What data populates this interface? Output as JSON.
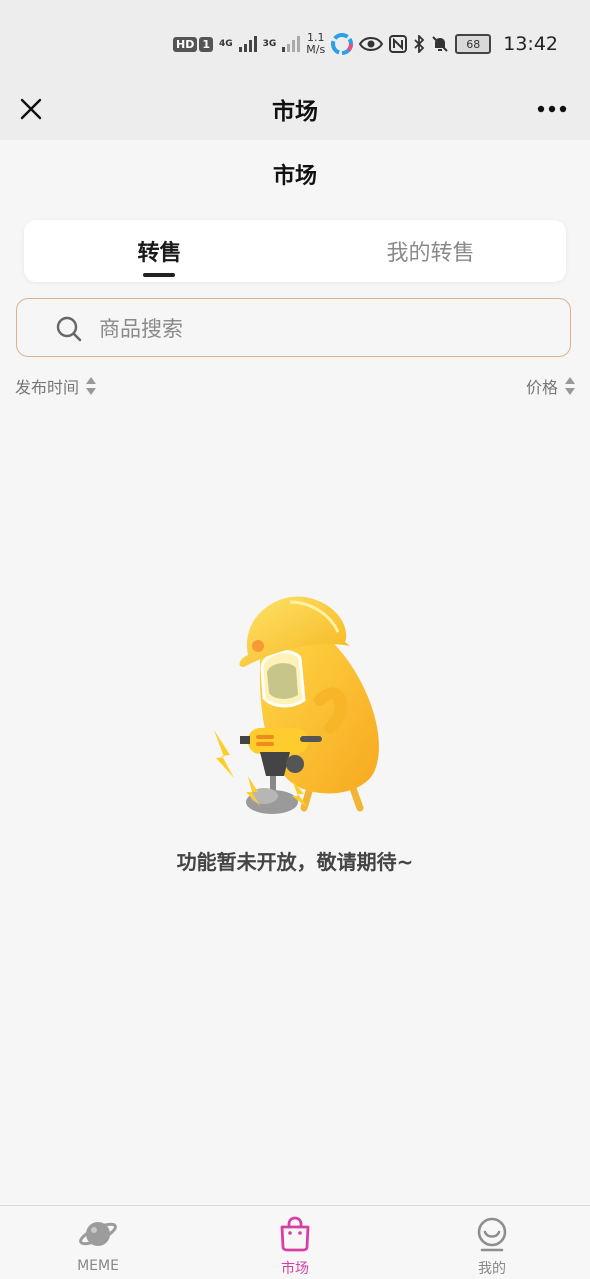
{
  "status_bar": {
    "hd": "HD",
    "sim": "1",
    "net1": "4G",
    "net2": "3G",
    "speed_value": "1.1",
    "speed_unit": "M/s",
    "battery": "68",
    "time": "13:42"
  },
  "nav": {
    "title": "市场"
  },
  "page": {
    "title": "市场"
  },
  "tabs": [
    {
      "label": "转售",
      "active": true
    },
    {
      "label": "我的转售",
      "active": false
    }
  ],
  "search": {
    "placeholder": "商品搜索",
    "value": ""
  },
  "sort": {
    "time_label": "发布时间",
    "price_label": "价格"
  },
  "empty_state": {
    "message": "功能暂未开放，敬请期待~"
  },
  "tabbar": {
    "items": [
      {
        "label": "MEME",
        "icon": "planet-icon",
        "active": false
      },
      {
        "label": "市场",
        "icon": "shopping-bag-icon",
        "active": true
      },
      {
        "label": "我的",
        "icon": "smile-icon",
        "active": false
      }
    ],
    "active_color": "#d83fa6"
  },
  "colors": {
    "search_border": "#d8b48f",
    "background": "#f6f6f6"
  }
}
